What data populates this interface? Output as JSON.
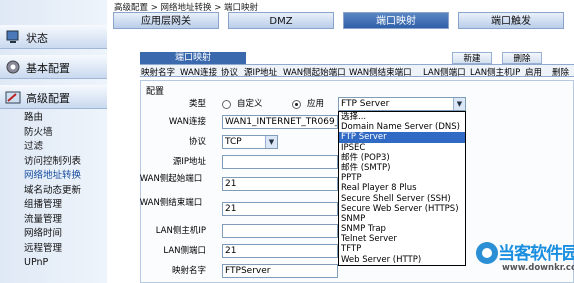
{
  "breadcrumb": "高级配置 > 网络地址转换 > 端口映射",
  "sidebar": {
    "groups": [
      {
        "label": "状态",
        "icon": "status-icon"
      },
      {
        "label": "基本配置",
        "icon": "gear-icon"
      },
      {
        "label": "高级配置",
        "icon": "tools-icon"
      }
    ],
    "items": [
      {
        "label": "路由"
      },
      {
        "label": "防火墙"
      },
      {
        "label": "过滤"
      },
      {
        "label": "访问控制列表"
      },
      {
        "label": "网络地址转换"
      },
      {
        "label": "域名动态更新"
      },
      {
        "label": "组播管理"
      },
      {
        "label": "流量管理"
      },
      {
        "label": "网络时间"
      },
      {
        "label": "远程管理"
      },
      {
        "label": "UPnP"
      }
    ]
  },
  "tabs": [
    {
      "label": "应用层网关"
    },
    {
      "label": "DMZ"
    },
    {
      "label": "端口映射"
    },
    {
      "label": "端口触发"
    }
  ],
  "subtab": "端口映射",
  "buttons": {
    "new": "新建",
    "delete": "删除",
    "delete_col": "删除"
  },
  "columns": [
    "映射名字",
    "WAN连接",
    "协议",
    "源IP地址",
    "WAN侧起始端口",
    "WAN侧结束端口",
    "LAN侧端口",
    "LAN侧主机IP",
    "启用"
  ],
  "config": {
    "title": "配置",
    "type_label": "类型",
    "type_custom": "自定义",
    "type_app": "应用",
    "app_value": "FTP Server",
    "wan_label": "WAN连接",
    "wan_value": "WAN1_INTERNET_TR069_R",
    "proto_label": "协议",
    "proto_value": "TCP",
    "srcip_label": "源IP地址",
    "srcip_value": "",
    "wan_start_label": "WAN侧起始端口",
    "wan_start_value": "21",
    "wan_end_label": "WAN侧结束端口",
    "wan_end_value": "21",
    "lan_host_label": "LAN侧主机IP",
    "lan_host_value": "",
    "lan_port_label": "LAN侧端口",
    "lan_port_value": "21",
    "map_name_label": "映射名字",
    "map_name_value": "FTPServer"
  },
  "dropdown_options": [
    "选择...",
    "Domain Name Server (DNS)",
    "FTP Server",
    "IPSEC",
    "邮件 (POP3)",
    "邮件 (SMTP)",
    "PPTP",
    "Real Player 8 Plus",
    "Secure Shell Server (SSH)",
    "Secure Web Server (HTTPS)",
    "SNMP",
    "SNMP Trap",
    "Telnet Server",
    "TFTP",
    "Web Server (HTTP)"
  ],
  "dropdown_selected_index": 2,
  "watermark": {
    "title": "当客软件园",
    "url": "www.downkr.com"
  },
  "colors": {
    "accent": "#3a69ae",
    "selected": "#316ac5",
    "watermark": "#1a8fe0"
  }
}
